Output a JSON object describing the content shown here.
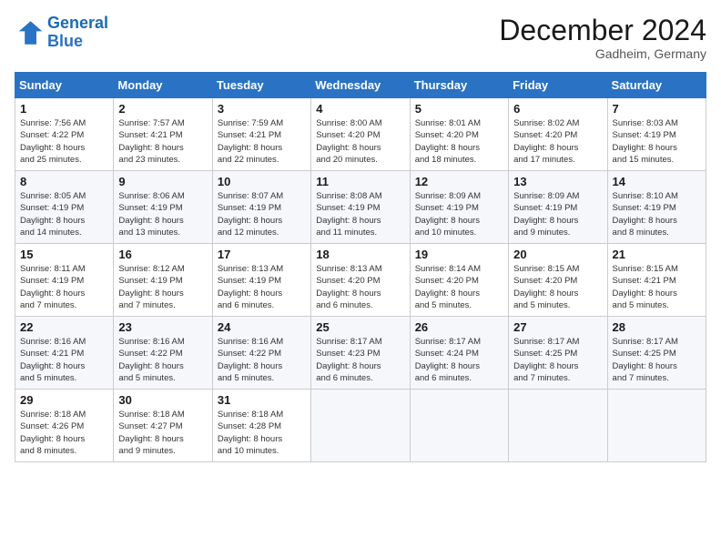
{
  "logo": {
    "line1": "General",
    "line2": "Blue"
  },
  "title": "December 2024",
  "location": "Gadheim, Germany",
  "days_of_week": [
    "Sunday",
    "Monday",
    "Tuesday",
    "Wednesday",
    "Thursday",
    "Friday",
    "Saturday"
  ],
  "weeks": [
    [
      {
        "day": 1,
        "info": "Sunrise: 7:56 AM\nSunset: 4:22 PM\nDaylight: 8 hours\nand 25 minutes."
      },
      {
        "day": 2,
        "info": "Sunrise: 7:57 AM\nSunset: 4:21 PM\nDaylight: 8 hours\nand 23 minutes."
      },
      {
        "day": 3,
        "info": "Sunrise: 7:59 AM\nSunset: 4:21 PM\nDaylight: 8 hours\nand 22 minutes."
      },
      {
        "day": 4,
        "info": "Sunrise: 8:00 AM\nSunset: 4:20 PM\nDaylight: 8 hours\nand 20 minutes."
      },
      {
        "day": 5,
        "info": "Sunrise: 8:01 AM\nSunset: 4:20 PM\nDaylight: 8 hours\nand 18 minutes."
      },
      {
        "day": 6,
        "info": "Sunrise: 8:02 AM\nSunset: 4:20 PM\nDaylight: 8 hours\nand 17 minutes."
      },
      {
        "day": 7,
        "info": "Sunrise: 8:03 AM\nSunset: 4:19 PM\nDaylight: 8 hours\nand 15 minutes."
      }
    ],
    [
      {
        "day": 8,
        "info": "Sunrise: 8:05 AM\nSunset: 4:19 PM\nDaylight: 8 hours\nand 14 minutes."
      },
      {
        "day": 9,
        "info": "Sunrise: 8:06 AM\nSunset: 4:19 PM\nDaylight: 8 hours\nand 13 minutes."
      },
      {
        "day": 10,
        "info": "Sunrise: 8:07 AM\nSunset: 4:19 PM\nDaylight: 8 hours\nand 12 minutes."
      },
      {
        "day": 11,
        "info": "Sunrise: 8:08 AM\nSunset: 4:19 PM\nDaylight: 8 hours\nand 11 minutes."
      },
      {
        "day": 12,
        "info": "Sunrise: 8:09 AM\nSunset: 4:19 PM\nDaylight: 8 hours\nand 10 minutes."
      },
      {
        "day": 13,
        "info": "Sunrise: 8:09 AM\nSunset: 4:19 PM\nDaylight: 8 hours\nand 9 minutes."
      },
      {
        "day": 14,
        "info": "Sunrise: 8:10 AM\nSunset: 4:19 PM\nDaylight: 8 hours\nand 8 minutes."
      }
    ],
    [
      {
        "day": 15,
        "info": "Sunrise: 8:11 AM\nSunset: 4:19 PM\nDaylight: 8 hours\nand 7 minutes."
      },
      {
        "day": 16,
        "info": "Sunrise: 8:12 AM\nSunset: 4:19 PM\nDaylight: 8 hours\nand 7 minutes."
      },
      {
        "day": 17,
        "info": "Sunrise: 8:13 AM\nSunset: 4:19 PM\nDaylight: 8 hours\nand 6 minutes."
      },
      {
        "day": 18,
        "info": "Sunrise: 8:13 AM\nSunset: 4:20 PM\nDaylight: 8 hours\nand 6 minutes."
      },
      {
        "day": 19,
        "info": "Sunrise: 8:14 AM\nSunset: 4:20 PM\nDaylight: 8 hours\nand 5 minutes."
      },
      {
        "day": 20,
        "info": "Sunrise: 8:15 AM\nSunset: 4:20 PM\nDaylight: 8 hours\nand 5 minutes."
      },
      {
        "day": 21,
        "info": "Sunrise: 8:15 AM\nSunset: 4:21 PM\nDaylight: 8 hours\nand 5 minutes."
      }
    ],
    [
      {
        "day": 22,
        "info": "Sunrise: 8:16 AM\nSunset: 4:21 PM\nDaylight: 8 hours\nand 5 minutes."
      },
      {
        "day": 23,
        "info": "Sunrise: 8:16 AM\nSunset: 4:22 PM\nDaylight: 8 hours\nand 5 minutes."
      },
      {
        "day": 24,
        "info": "Sunrise: 8:16 AM\nSunset: 4:22 PM\nDaylight: 8 hours\nand 5 minutes."
      },
      {
        "day": 25,
        "info": "Sunrise: 8:17 AM\nSunset: 4:23 PM\nDaylight: 8 hours\nand 6 minutes."
      },
      {
        "day": 26,
        "info": "Sunrise: 8:17 AM\nSunset: 4:24 PM\nDaylight: 8 hours\nand 6 minutes."
      },
      {
        "day": 27,
        "info": "Sunrise: 8:17 AM\nSunset: 4:25 PM\nDaylight: 8 hours\nand 7 minutes."
      },
      {
        "day": 28,
        "info": "Sunrise: 8:17 AM\nSunset: 4:25 PM\nDaylight: 8 hours\nand 7 minutes."
      }
    ],
    [
      {
        "day": 29,
        "info": "Sunrise: 8:18 AM\nSunset: 4:26 PM\nDaylight: 8 hours\nand 8 minutes."
      },
      {
        "day": 30,
        "info": "Sunrise: 8:18 AM\nSunset: 4:27 PM\nDaylight: 8 hours\nand 9 minutes."
      },
      {
        "day": 31,
        "info": "Sunrise: 8:18 AM\nSunset: 4:28 PM\nDaylight: 8 hours\nand 10 minutes."
      },
      null,
      null,
      null,
      null
    ]
  ]
}
